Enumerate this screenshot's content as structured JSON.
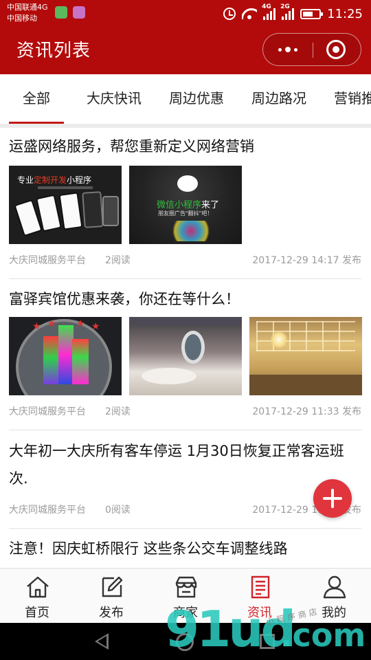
{
  "status_bar": {
    "carrier_1": "中国联通4G",
    "carrier_2": "中国移动",
    "sig1_tag": "4G",
    "sig2_tag": "2G",
    "time": "11:25"
  },
  "header": {
    "title": "资讯列表"
  },
  "tabs": [
    {
      "label": "全部",
      "active": true
    },
    {
      "label": "大庆快讯",
      "active": false
    },
    {
      "label": "周边优惠",
      "active": false
    },
    {
      "label": "周边路况",
      "active": false
    },
    {
      "label": "营销推",
      "active": false
    }
  ],
  "articles": [
    {
      "title": "运盛网络服务，帮您重新定义网络营销",
      "images": [
        {
          "icon": "custom-dev-banner",
          "line1_a": "专业",
          "line1_hl": "定制开发",
          "line1_b": "小程序"
        },
        {
          "icon": "wechat-miniprogram-banner",
          "label_a": "微信小程序",
          "label_b": "来了",
          "sub": "朋友圈广告\"翻抖\"吧！"
        }
      ],
      "source": "大庆同城服务平台",
      "reads": "2阅读",
      "time": "2017-12-29 14:17 发布"
    },
    {
      "title": "富驿宾馆优惠来袭，你还在等什么！",
      "images": [
        {
          "icon": "hotel-logo"
        },
        {
          "icon": "hotel-room"
        },
        {
          "icon": "hotel-lobby"
        }
      ],
      "source": "大庆同城服务平台",
      "reads": "2阅读",
      "time": "2017-12-29 11:33 发布"
    },
    {
      "title": "大年初一大庆所有客车停运 1月30日恢复正常客运班次.",
      "images": [],
      "source": "大庆同城服务平台",
      "reads": "0阅读",
      "time": "2017-12-29 11:15 发布"
    },
    {
      "title": "注意！因庆虹桥限行 这些条公交车调整线路",
      "images": [],
      "source": "",
      "reads": "",
      "time": ""
    }
  ],
  "tabbar": [
    {
      "label": "首页",
      "icon": "home-icon",
      "active": false
    },
    {
      "label": "发布",
      "icon": "edit-icon",
      "active": false
    },
    {
      "label": "商家",
      "icon": "store-icon",
      "active": false
    },
    {
      "label": "资讯",
      "icon": "news-icon",
      "active": true
    },
    {
      "label": "我的",
      "icon": "user-icon",
      "active": false
    }
  ],
  "watermark": {
    "main": "91ud",
    "dot": ".com",
    "small": "小程序商店"
  },
  "colors": {
    "header_bg": "#b30b0b",
    "tab_active": "#c21818",
    "fab": "#e0353d",
    "tabbar_active": "#d1222a"
  }
}
